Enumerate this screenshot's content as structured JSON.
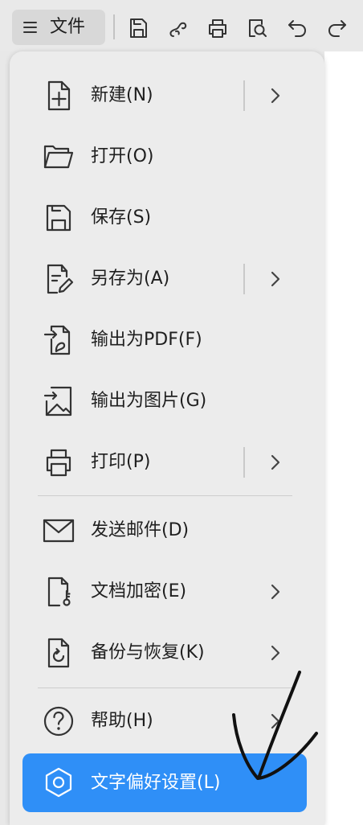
{
  "toolbar": {
    "file_button": {
      "label": "文件",
      "icon": "menu-icon"
    },
    "action_icons": [
      "save-icon",
      "share-icon",
      "print-icon",
      "print-preview-icon",
      "undo-icon",
      "redo-icon"
    ]
  },
  "file_menu": {
    "groups": [
      {
        "items": [
          {
            "label": "新建(N)",
            "icon": "new-document-icon",
            "submenu": true,
            "split_button": true
          },
          {
            "label": "打开(O)",
            "icon": "folder-open-icon",
            "submenu": false
          },
          {
            "label": "保存(S)",
            "icon": "save-icon",
            "submenu": false
          },
          {
            "label": "另存为(A)",
            "icon": "save-as-icon",
            "submenu": true,
            "split_button": true
          },
          {
            "label": "输出为PDF(F)",
            "icon": "export-pdf-icon",
            "submenu": false
          },
          {
            "label": "输出为图片(G)",
            "icon": "export-image-icon",
            "submenu": false
          },
          {
            "label": "打印(P)",
            "icon": "print-icon",
            "submenu": true,
            "split_button": true
          }
        ]
      },
      {
        "items": [
          {
            "label": "发送邮件(D)",
            "icon": "mail-icon",
            "submenu": false
          },
          {
            "label": "文档加密(E)",
            "icon": "document-key-icon",
            "submenu": true
          },
          {
            "label": "备份与恢复(K)",
            "icon": "backup-restore-icon",
            "submenu": true
          }
        ]
      },
      {
        "items": [
          {
            "label": "帮助(H)",
            "icon": "help-icon",
            "submenu": true
          },
          {
            "label": "文字偏好设置(L)",
            "icon": "settings-hexagon-icon",
            "submenu": false,
            "highlighted": true
          }
        ]
      }
    ]
  },
  "colors": {
    "accent": "#2f8ff7",
    "text": "#1f1f1f",
    "icon": "#333333",
    "panel_bg": "#ececec",
    "active_text": "#ffffff",
    "handwriting": "#111111"
  }
}
